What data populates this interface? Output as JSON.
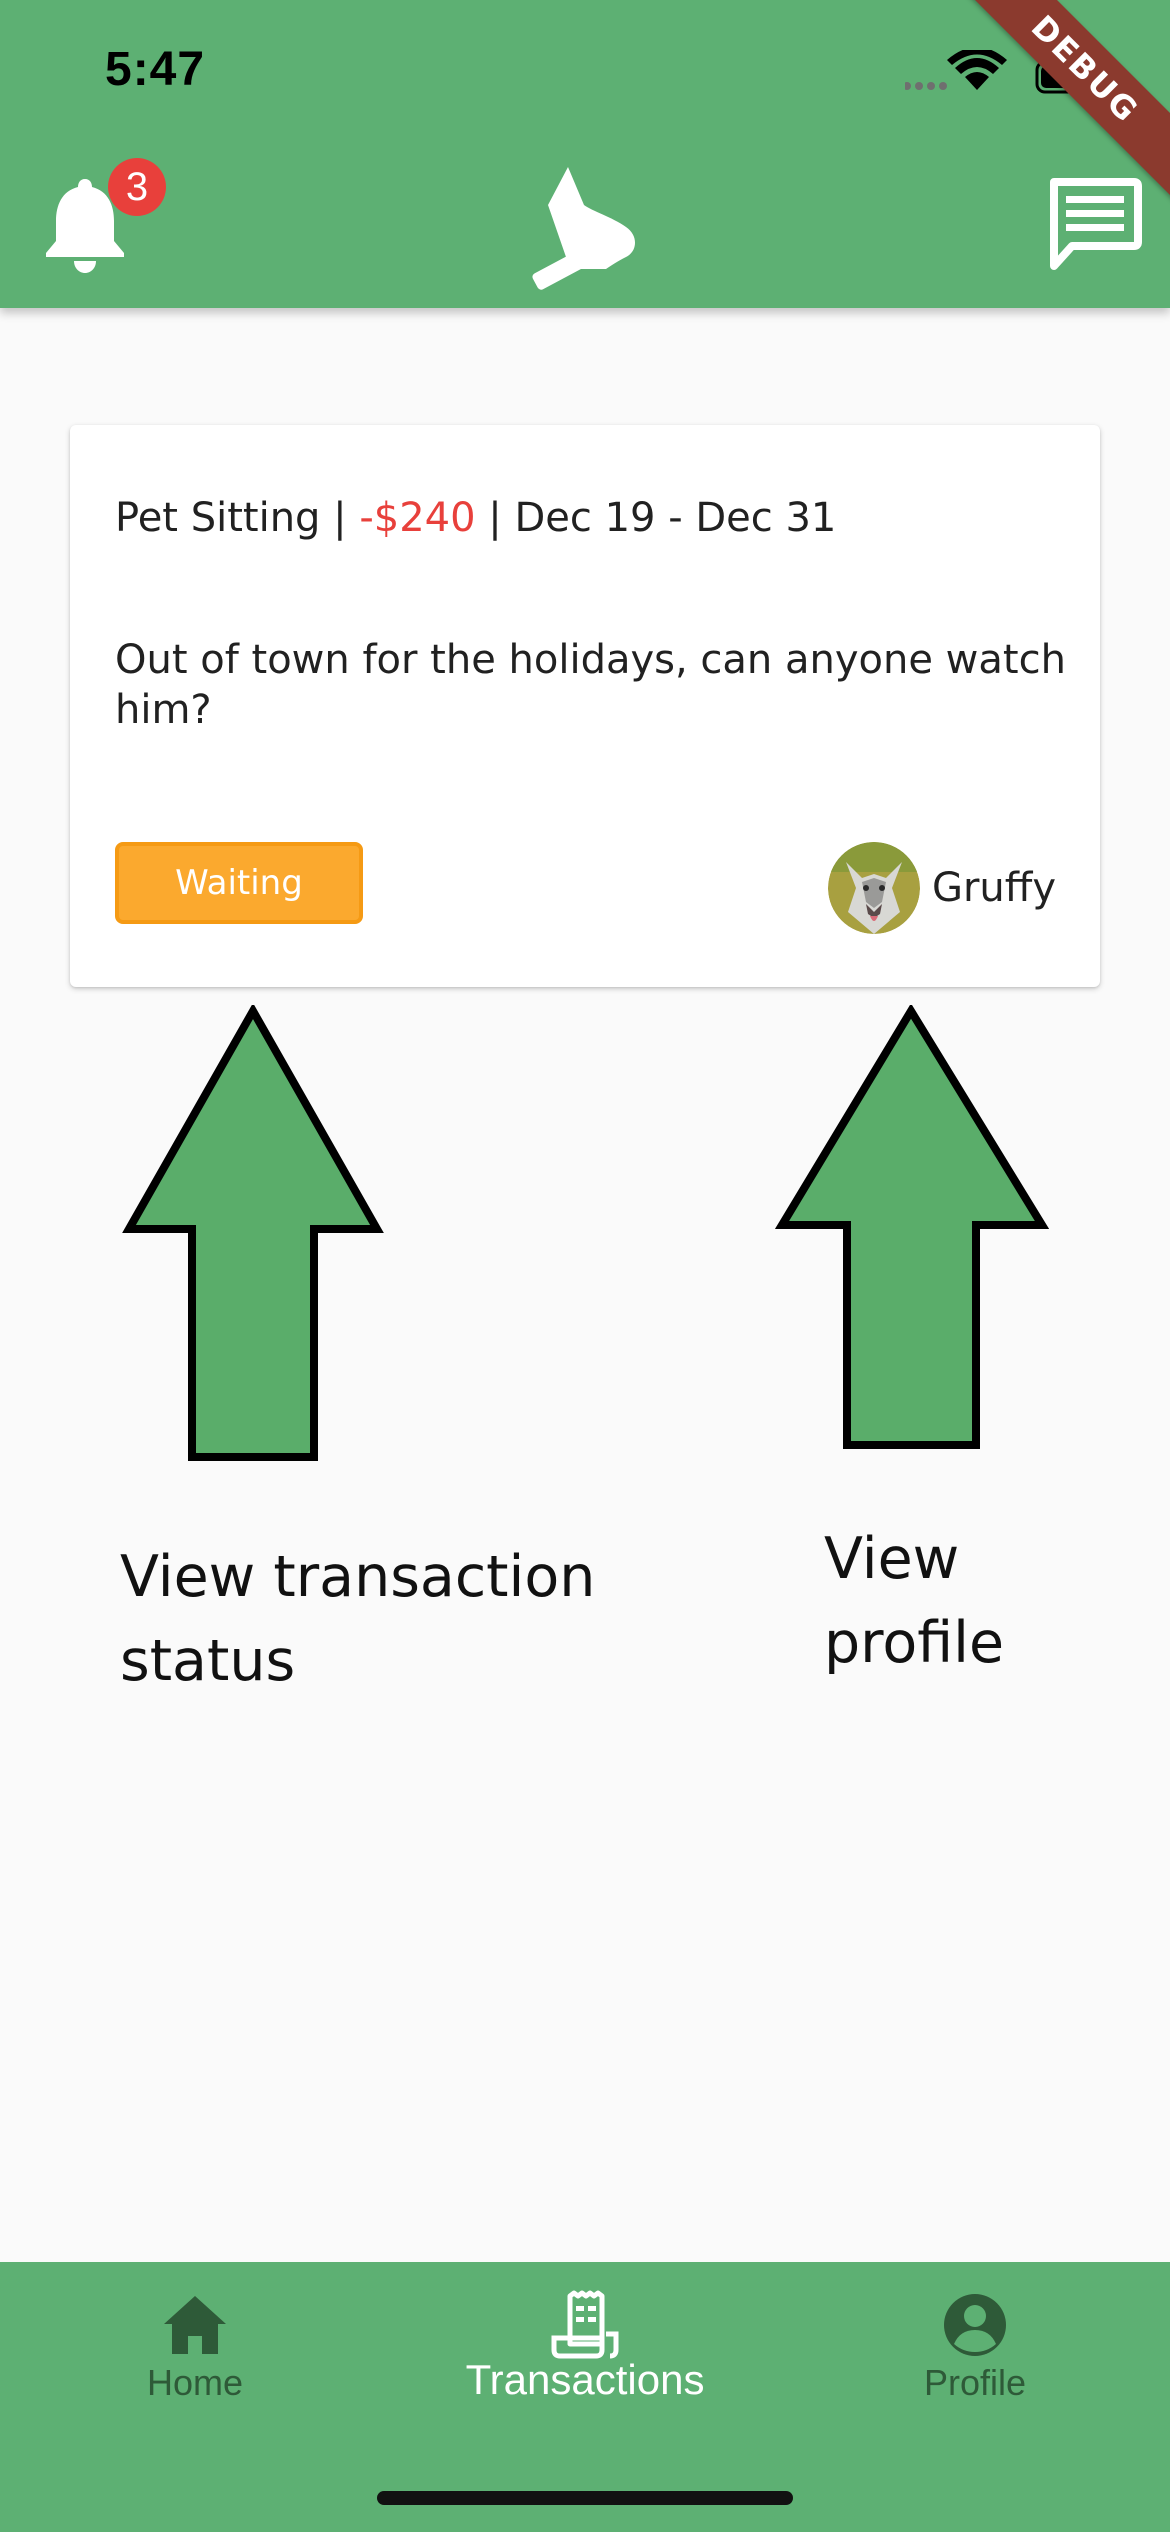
{
  "status_bar": {
    "time": "5:47"
  },
  "debug_banner": {
    "label": "DEBUG"
  },
  "app_bar": {
    "notification_count": "3",
    "icons": [
      "bell-icon",
      "dog-logo-icon",
      "chat-icon"
    ]
  },
  "transaction": {
    "service": "Pet Sitting",
    "separator": " | ",
    "amount": "-$240",
    "dates": "Dec 19 - Dec 31",
    "description": "Out of town for the holidays, can anyone watch him?",
    "status": "Waiting",
    "pet_name": "Gruffy"
  },
  "annotations": {
    "left_line1": "View transaction",
    "left_line2": "status",
    "right_line1": "View",
    "right_line2": "profile"
  },
  "bottom_nav": {
    "items": [
      {
        "label": "Home",
        "icon": "home-icon"
      },
      {
        "label": "Transactions",
        "icon": "receipt-icon",
        "active": true
      },
      {
        "label": "Profile",
        "icon": "account-circle-icon"
      }
    ]
  },
  "colors": {
    "primary": "#5db073",
    "amount_negative": "#e8403b",
    "status_waiting": "#fba92e",
    "badge": "#e8403b",
    "nav_inactive": "#2e5a38",
    "annotation_arrow": "#5aad6a"
  }
}
